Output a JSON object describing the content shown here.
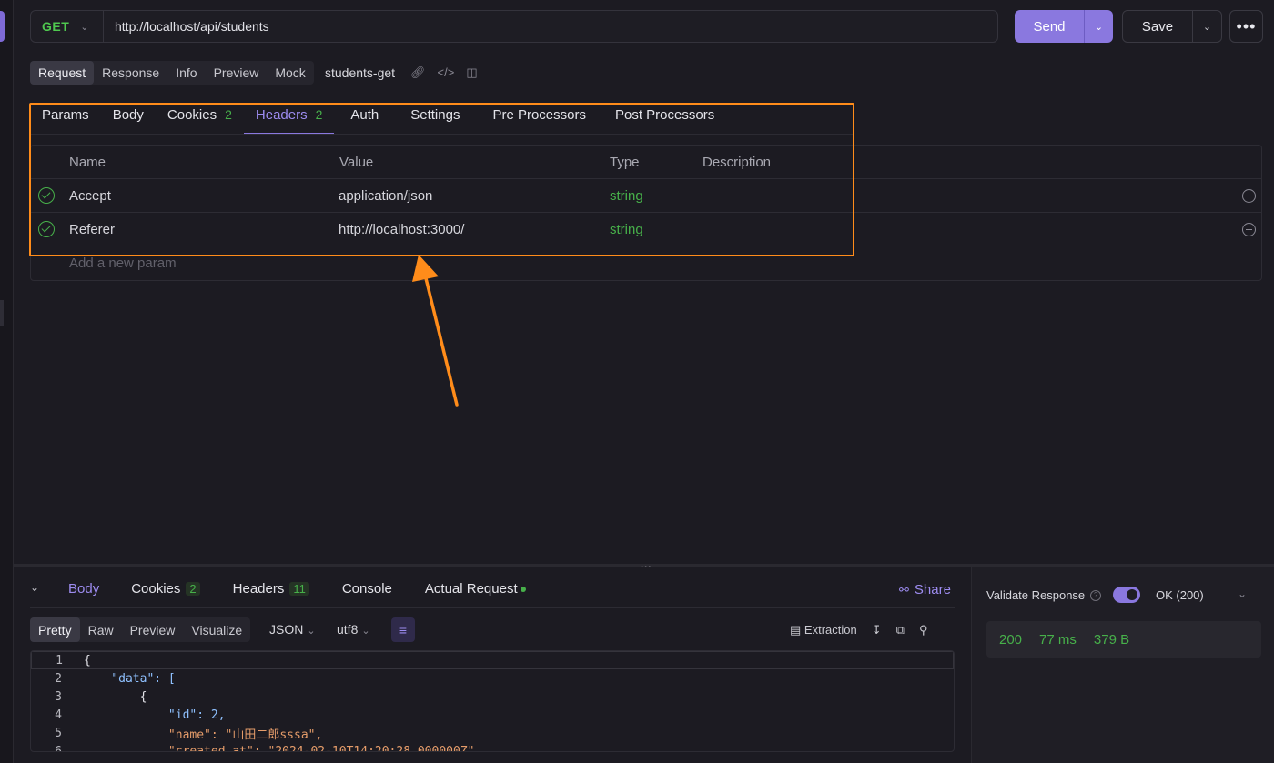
{
  "request": {
    "method": "GET",
    "url": "http://localhost/api/students",
    "send_label": "Send",
    "save_label": "Save",
    "more_label": "•••",
    "name": "students-get"
  },
  "mode_tabs": [
    "Request",
    "Response",
    "Info",
    "Preview",
    "Mock"
  ],
  "request_tabs": [
    {
      "label": "Params",
      "badge": ""
    },
    {
      "label": "Body",
      "badge": ""
    },
    {
      "label": "Cookies",
      "badge": "2"
    },
    {
      "label": "Headers",
      "badge": "2"
    },
    {
      "label": "Auth",
      "badge": ""
    },
    {
      "label": "Settings",
      "badge": ""
    },
    {
      "label": "Pre Processors",
      "badge": ""
    },
    {
      "label": "Post Processors",
      "badge": ""
    }
  ],
  "headers_table": {
    "columns": [
      "Name",
      "Value",
      "Type",
      "Description"
    ],
    "rows": [
      {
        "name": "Accept",
        "value": "application/json",
        "type": "string",
        "description": ""
      },
      {
        "name": "Referer",
        "value": "http://localhost:3000/",
        "type": "string",
        "description": ""
      }
    ],
    "add_placeholder": "Add a new param"
  },
  "response": {
    "tabs": [
      {
        "label": "Body",
        "badge": ""
      },
      {
        "label": "Cookies",
        "badge": "2"
      },
      {
        "label": "Headers",
        "badge": "11"
      },
      {
        "label": "Console",
        "badge": ""
      },
      {
        "label": "Actual Request",
        "badge": ""
      }
    ],
    "share_label": "Share",
    "format_tabs": [
      "Pretty",
      "Raw",
      "Preview",
      "Visualize"
    ],
    "format": "JSON",
    "encoding": "utf8",
    "extraction_label": "Extraction",
    "code_lines": [
      {
        "n": "1",
        "text": "{"
      },
      {
        "n": "2",
        "text": "    \"data\": ["
      },
      {
        "n": "3",
        "text": "        {"
      },
      {
        "n": "4",
        "text": "            \"id\": 2,"
      },
      {
        "n": "5",
        "text": "            \"name\": \"山田二郎sssa\","
      },
      {
        "n": "6",
        "text": "            \"created_at\": \"2024-02-10T14:20:28.000000Z\","
      }
    ]
  },
  "validate": {
    "label": "Validate Response",
    "enabled": true,
    "status_option": "OK (200)",
    "status_code": "200",
    "time": "77 ms",
    "size": "379 B"
  },
  "colors": {
    "accent": "#8a78df",
    "success": "#47b04a",
    "highlight": "#ff8c1a"
  }
}
